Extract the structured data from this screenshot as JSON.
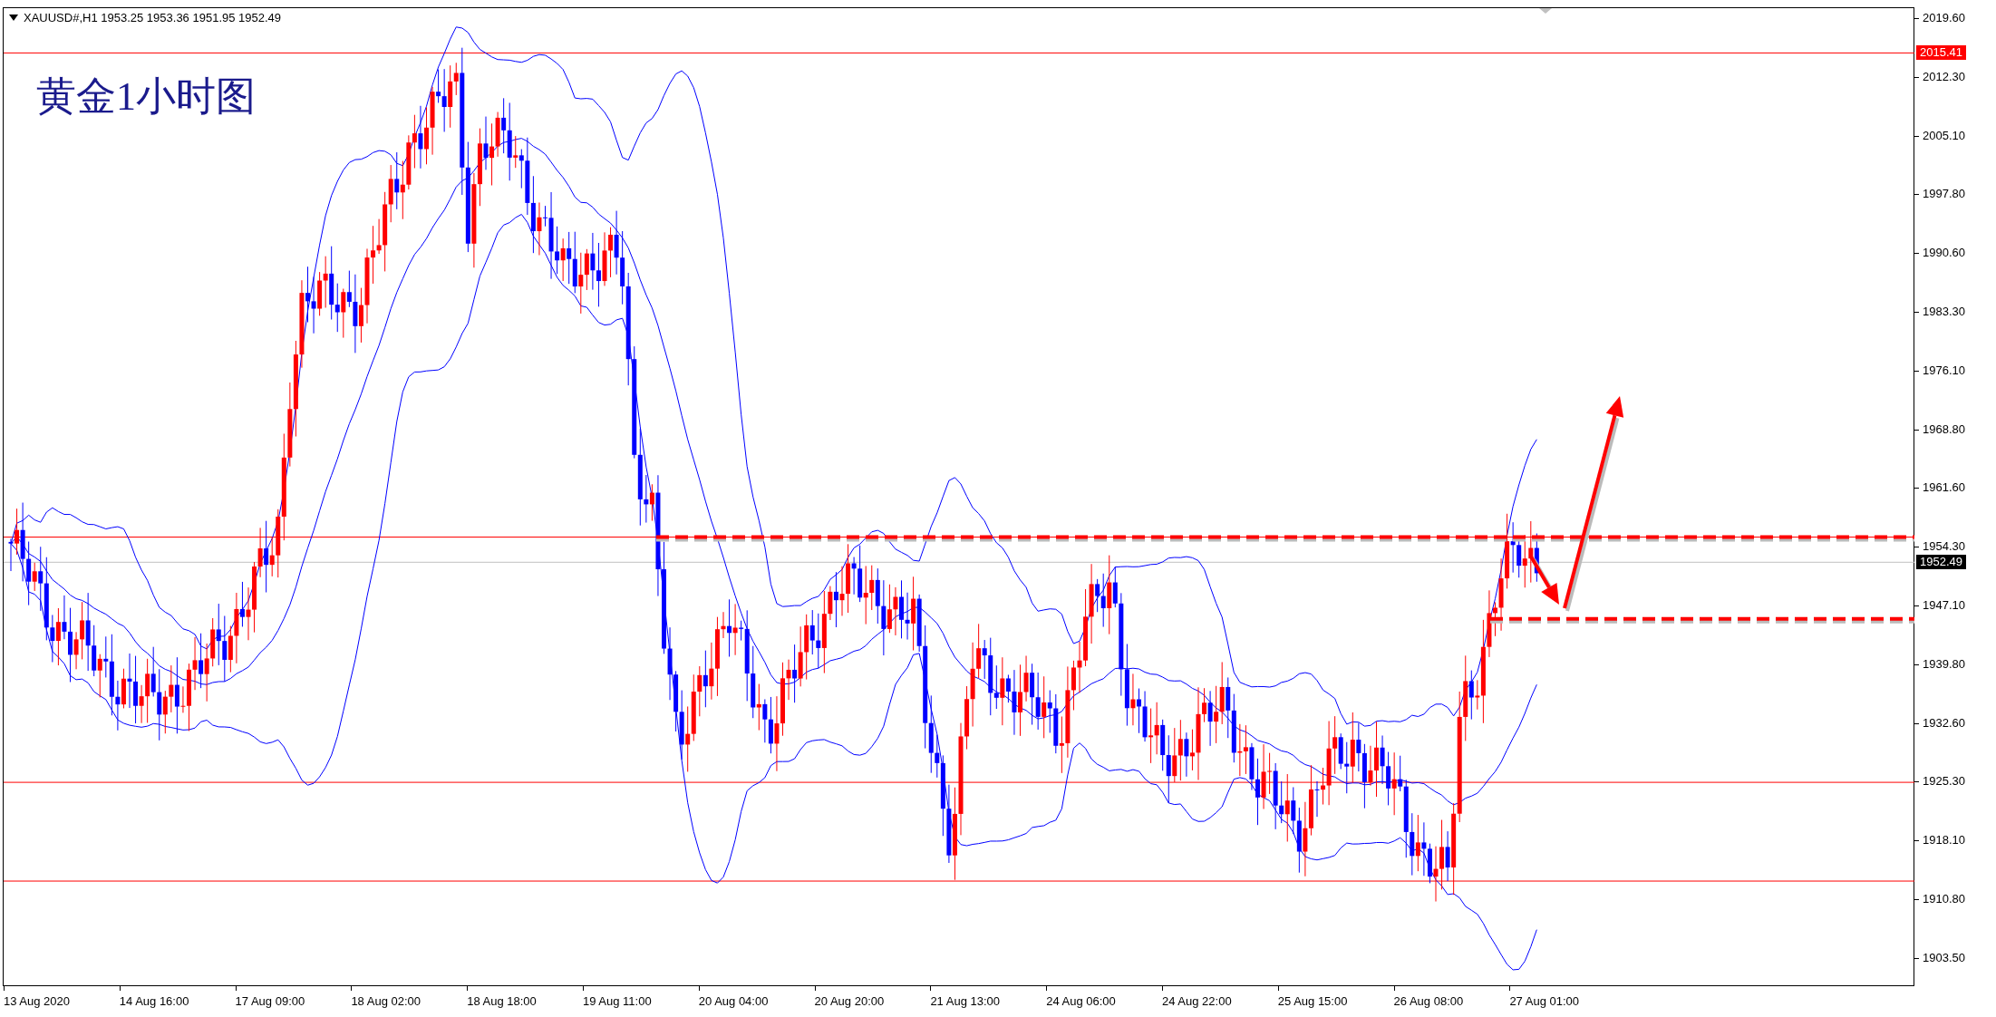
{
  "header": {
    "symbol_line": "XAUUSD#,H1  1953.25 1953.36 1951.95 1952.49"
  },
  "chart": {
    "title": "黄金1小时图",
    "price_axis": [
      "2019.60",
      "2012.30",
      "2005.10",
      "1997.80",
      "1990.60",
      "1983.30",
      "1976.10",
      "1968.80",
      "1961.60",
      "1954.30",
      "1947.10",
      "1939.80",
      "1932.60",
      "1925.30",
      "1918.10",
      "1910.80",
      "1903.50"
    ],
    "time_axis": [
      "13 Aug 2020",
      "14 Aug 16:00",
      "17 Aug 09:00",
      "18 Aug 02:00",
      "18 Aug 18:00",
      "19 Aug 11:00",
      "20 Aug 04:00",
      "20 Aug 20:00",
      "21 Aug 13:00",
      "24 Aug 06:00",
      "24 Aug 22:00",
      "25 Aug 15:00",
      "26 Aug 08:00",
      "27 Aug 01:00"
    ],
    "tags": [
      {
        "text": "2015.41",
        "kind": "level"
      },
      {
        "text": "1952.49",
        "kind": "bid"
      }
    ]
  }
}
